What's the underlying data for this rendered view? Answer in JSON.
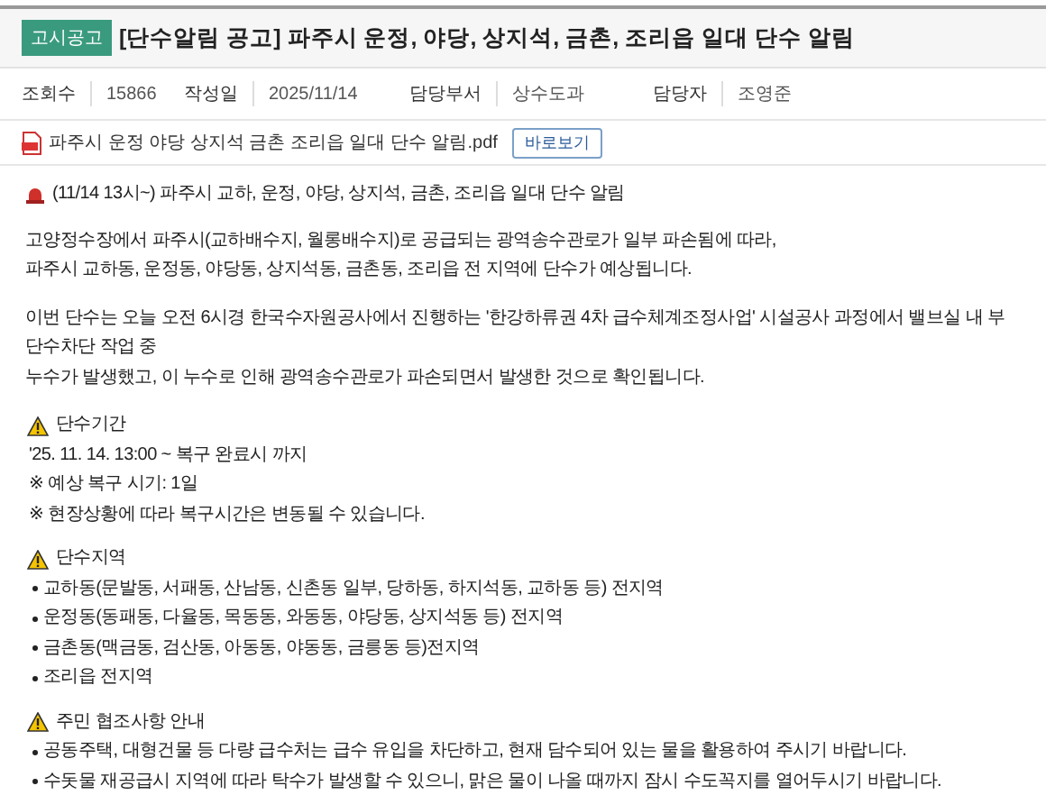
{
  "header": {
    "badge": "고시공고",
    "title": "[단수알림 공고] 파주시 운정, 야당, 상지석, 금촌, 조리읍 일대 단수 알림"
  },
  "meta": [
    {
      "label": "조회수",
      "value": "15866"
    },
    {
      "label": "작성일",
      "value": "2025/11/14"
    },
    {
      "label": "담당부서",
      "value": "상수도과"
    },
    {
      "label": "담당자",
      "value": "조영준"
    }
  ],
  "attachment": {
    "file_name": "파주시 운정 야당 상지석 금촌 조리읍 일대 단수 알림.pdf",
    "view_button": "바로보기"
  },
  "content": {
    "headline": "(11/14 13시~) 파주시 교하, 운정, 야당, 상지석, 금촌, 조리읍 일대 단수 알림",
    "paragraphs": [
      [
        "고양정수장에서 파주시(교하배수지, 월롱배수지)로 공급되는 광역송수관로가 일부 파손됨에 따라,",
        "파주시 교하동, 운정동, 야당동, 상지석동, 금촌동, 조리읍 전 지역에 단수가 예상됩니다."
      ],
      [
        "이번 단수는 오늘 오전 6시경 한국수자원공사에서 진행하는 '한강하류권 4차 급수체계조정사업' 시설공사 과정에서 밸브실 내 부단수차단 작업 중",
        "누수가 발생했고, 이 누수로 인해 광역송수관로가 파손되면서 발생한 것으로 확인됩니다."
      ]
    ],
    "sections": [
      {
        "heading": "단수기간",
        "kind": "plain",
        "lines": [
          "'25. 11. 14. 13:00 ~ 복구 완료시 까지",
          "※ 예상 복구 시기: 1일",
          "※ 현장상황에 따라 복구시간은 변동될 수 있습니다."
        ]
      },
      {
        "heading": "단수지역",
        "kind": "bullets",
        "lines": [
          "교하동(문발동, 서패동, 산남동, 신촌동 일부, 당하동, 하지석동, 교하동 등) 전지역",
          "운정동(동패동, 다율동, 목동동, 와동동, 야당동, 상지석동 등) 전지역",
          "금촌동(맥금동, 검산동, 아동동, 야동동, 금릉동 등)전지역",
          "조리읍 전지역"
        ]
      },
      {
        "heading": "주민 협조사항 안내",
        "kind": "bullets",
        "lines": [
          "공동주택, 대형건물 등 다량 급수처는 급수 유입을 차단하고, 현재 담수되어 있는 물을 활용하여 주시기 바랍니다.",
          "수돗물 재공급시 지역에 따라 탁수가 발생할 수 있으니, 맑은 물이 나올 때까지 잠시 수도꼭지를 열어두시기 바랍니다."
        ]
      }
    ]
  }
}
